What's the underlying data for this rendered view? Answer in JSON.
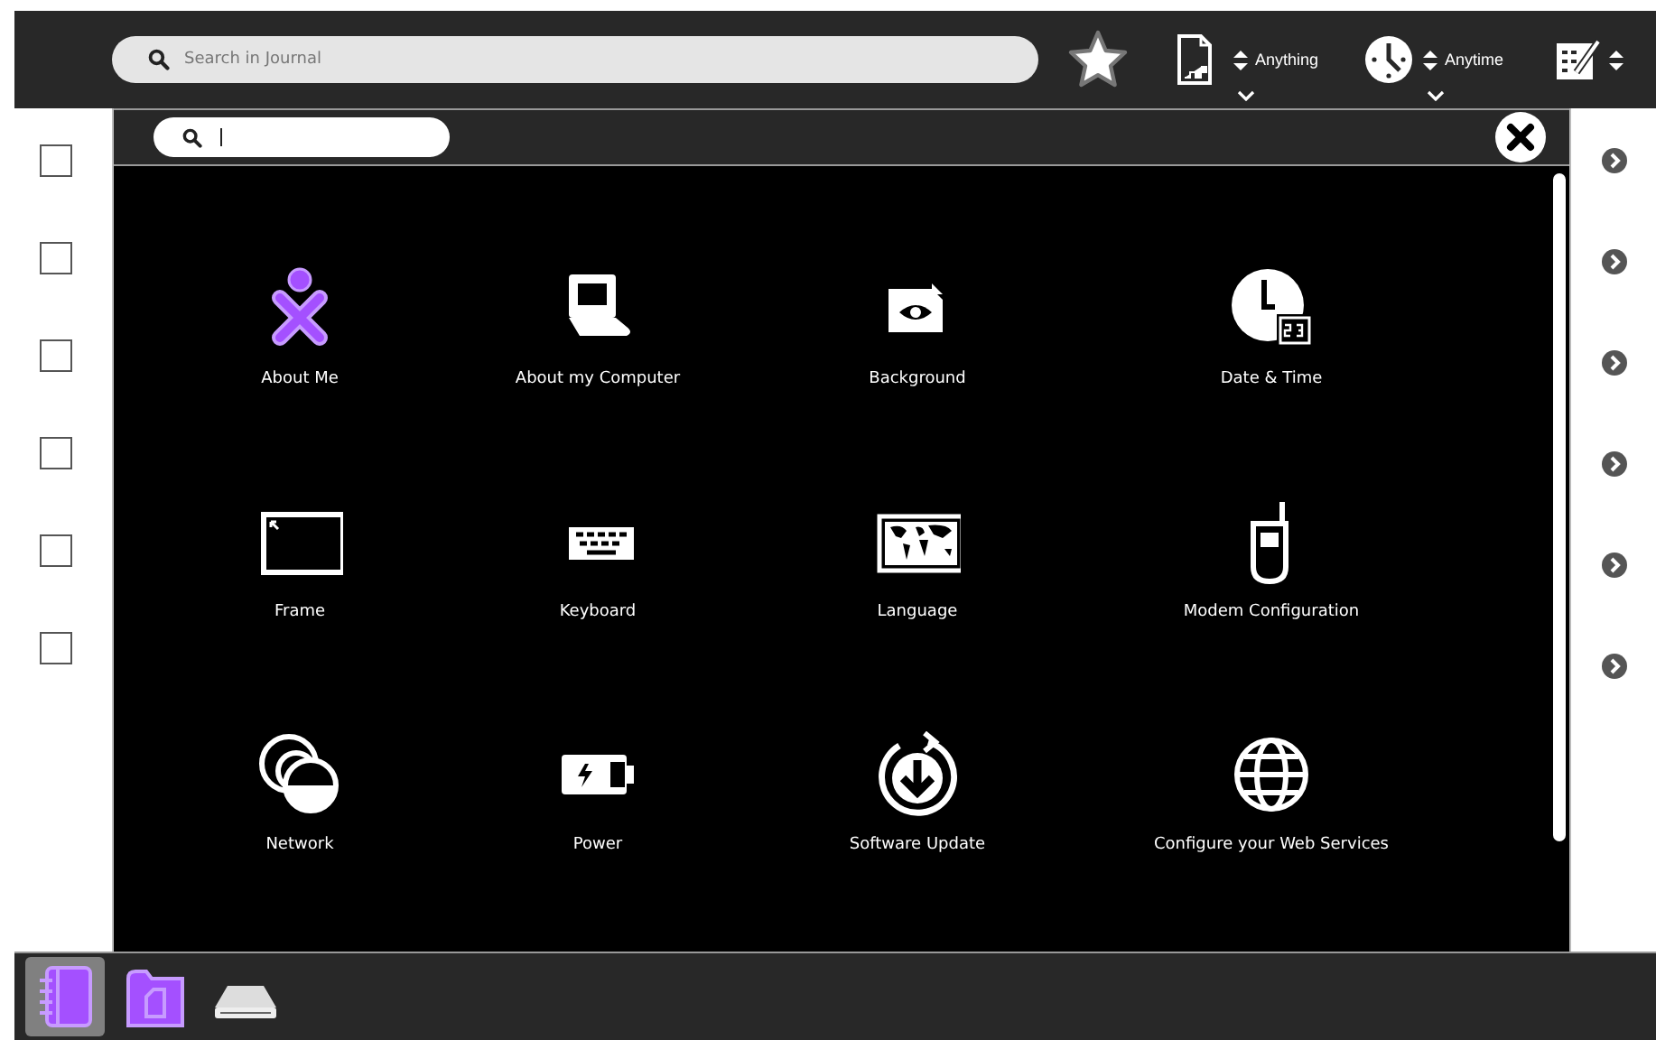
{
  "toolbar": {
    "search": {
      "placeholder": "Search in Journal"
    },
    "filters": [
      {
        "kind": "type",
        "label": "Anything"
      },
      {
        "kind": "time",
        "label": "Anytime"
      }
    ]
  },
  "journal_rows": [
    {
      "checked": false
    },
    {
      "checked": false
    },
    {
      "checked": false
    },
    {
      "checked": false
    },
    {
      "checked": false
    },
    {
      "checked": false
    }
  ],
  "settings_dialog": {
    "items": [
      {
        "kind": "person",
        "label": "About Me"
      },
      {
        "kind": "computer",
        "label": "About my Computer"
      },
      {
        "kind": "background",
        "label": "Background"
      },
      {
        "kind": "clock",
        "label": "Date & Time"
      },
      {
        "kind": "frame",
        "label": "Frame"
      },
      {
        "kind": "keyboard",
        "label": "Keyboard"
      },
      {
        "kind": "map",
        "label": "Language"
      },
      {
        "kind": "phone",
        "label": "Modem Configuration"
      },
      {
        "kind": "network",
        "label": "Network"
      },
      {
        "kind": "battery",
        "label": "Power"
      },
      {
        "kind": "update",
        "label": "Software Update"
      },
      {
        "kind": "globe",
        "label": "Configure your Web Services"
      }
    ]
  },
  "tray": [
    {
      "kind": "journal",
      "selected": true
    },
    {
      "kind": "folder",
      "selected": false
    },
    {
      "kind": "drive",
      "selected": false
    }
  ]
}
